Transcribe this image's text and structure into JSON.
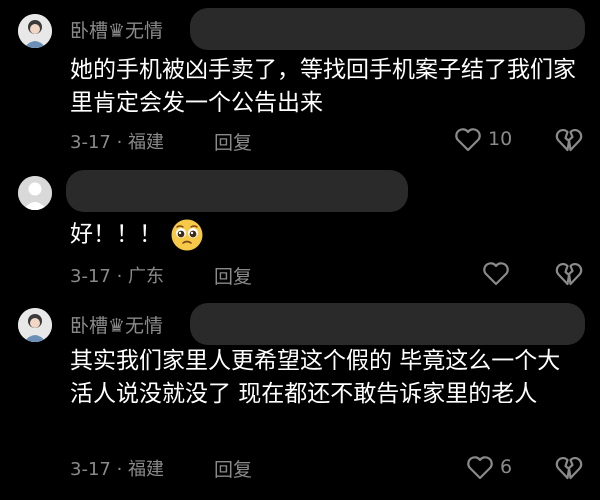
{
  "comments": [
    {
      "username": "卧槽♛无情",
      "text": "她的手机被凶手卖了，等找回手机案子结了我们家里肯定会发一个公告出来",
      "meta": "3-17 · 福建",
      "reply_label": "回复",
      "like_count": "10"
    },
    {
      "username": "",
      "text": "好！！！",
      "meta": "3-17 · 广东",
      "reply_label": "回复",
      "like_count": ""
    },
    {
      "username": "卧槽♛无情",
      "text": "其实我们家里人更希望这个假的 毕竟这么一个大活人说没就没了 现在都还不敢告诉家里的老人",
      "meta": "3-17 · 福建",
      "reply_label": "回复",
      "like_count": "6"
    }
  ],
  "icons": {
    "like": "heart-outline-icon",
    "dislike": "broken-heart-icon",
    "emoji": "pleading-face-emoji"
  },
  "colors": {
    "background": "#000000",
    "text": "#ffffff",
    "muted": "#8a8a8a"
  }
}
